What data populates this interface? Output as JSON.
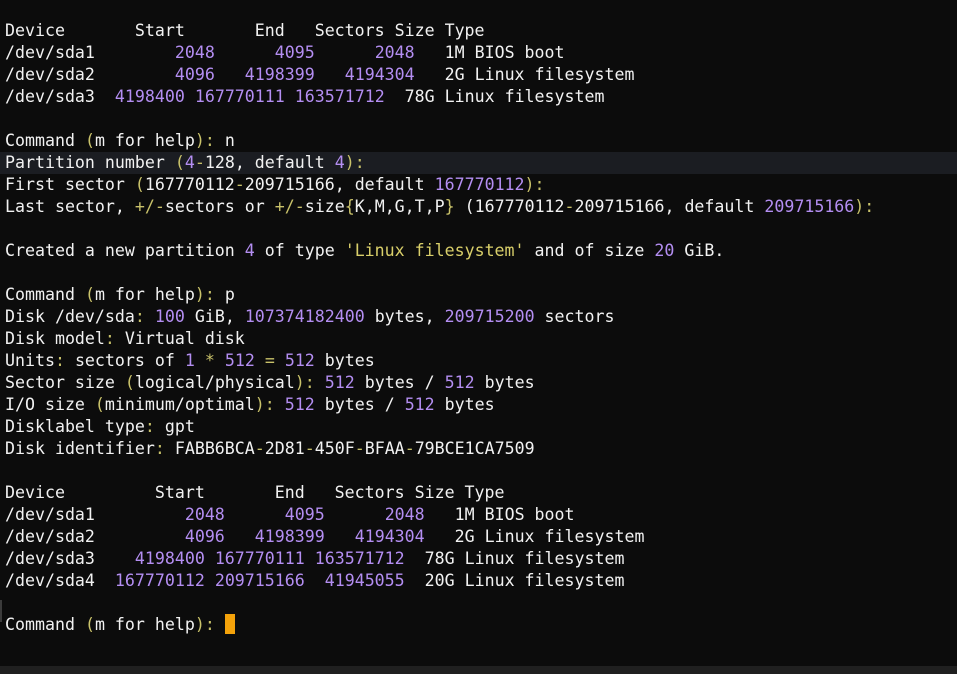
{
  "table1": {
    "header": "Device       Start       End   Sectors Size Type",
    "rows": [
      {
        "dev": "/dev/sda1     ",
        "start": "   2048",
        "sp1": "      ",
        "end": "4095",
        "sp2": "      ",
        "sectors": "2048",
        "size": "   1M",
        "type": " BIOS boot"
      },
      {
        "dev": "/dev/sda2     ",
        "start": "   4096",
        "sp1": "   ",
        "end": "4198399",
        "sp2": "   ",
        "sectors": "4194304",
        "size": "   2G",
        "type": " Linux filesystem"
      },
      {
        "dev": "/dev/sda3  ",
        "start": "4198400",
        "sp1": " ",
        "end": "167770111",
        "sp2": " ",
        "sectors": "163571712",
        "size": "  78G",
        "type": " Linux filesystem"
      }
    ]
  },
  "cmd1": {
    "prompt": "Command ",
    "paren_open": "(",
    "m": "m for help",
    "paren_close": ")",
    "colon": ":",
    "input": " n"
  },
  "partnum": {
    "a": "Partition number ",
    "b": "(",
    "c": "4",
    "d": "-",
    "e": "128, default ",
    "f": "4",
    "g": "):"
  },
  "firstsector": {
    "a": "First sector ",
    "b": "(",
    "c": "167770112",
    "d": "-",
    "e": "209715166, default ",
    "f": "167770112",
    "g": "):"
  },
  "lastsector": {
    "a": "Last sector, ",
    "b": "+/",
    "c": "-",
    "d": "sectors or ",
    "e": "+/",
    "f": "-",
    "g": "size",
    "h": "{",
    "i": "K,M,G,T,P",
    "j": "}",
    "k": " (",
    "l": "167770112",
    "m": "-",
    "n": "209715166, default ",
    "o": "209715166",
    "p": "):"
  },
  "created": {
    "a": "Created a new partition ",
    "b": "4",
    "c": " of type ",
    "d": "'Linux filesystem'",
    "e": " and of size ",
    "f": "20",
    "g": " GiB."
  },
  "cmd2": {
    "prompt": "Command ",
    "paren_open": "(",
    "m": "m for help",
    "paren_close": ")",
    "colon": ":",
    "input": " p"
  },
  "disk": {
    "a": "Disk /dev/sda",
    "b": ":",
    "c": " ",
    "d": "100",
    "e": " GiB, ",
    "f": "107374182400",
    "g": " bytes, ",
    "h": "209715200",
    "i": " sectors"
  },
  "model": {
    "a": "Disk model",
    "b": ":",
    "c": " Virtual disk"
  },
  "units": {
    "a": "Units",
    "b": ":",
    "c": " sectors of ",
    "d": "1",
    "e": " ",
    "f": "*",
    "g": " ",
    "h": "512",
    "i": " ",
    "j": "=",
    "k": " ",
    "l": "512",
    "m": " bytes"
  },
  "sectorsize": {
    "a": "Sector size ",
    "b": "(",
    "c": "logical/physical",
    "d": ")",
    "e": ":",
    "f": " ",
    "g": "512",
    "h": " bytes / ",
    "i": "512",
    "j": " bytes"
  },
  "iosize": {
    "a": "I/O size ",
    "b": "(",
    "c": "minimum/optimal",
    "d": ")",
    "e": ":",
    "f": " ",
    "g": "512",
    "h": " bytes / ",
    "i": "512",
    "j": " bytes"
  },
  "labeltype": {
    "a": "Disklabel type",
    "b": ":",
    "c": " gpt"
  },
  "identifier": {
    "a": "Disk identifier",
    "b": ":",
    "c": " FABB6BCA",
    "d": "-",
    "e": "2D81",
    "f": "-",
    "g": "450F",
    "h": "-",
    "i": "BFAA",
    "j": "-",
    "k": "79BCE1CA7509"
  },
  "table2": {
    "header": "Device         Start       End   Sectors Size Type",
    "rows": [
      {
        "dev": "/dev/sda1       ",
        "start": "  2048",
        "sp1": "      ",
        "end": "4095",
        "sp2": "      ",
        "sectors": "2048",
        "size": "   1M",
        "type": " BIOS boot"
      },
      {
        "dev": "/dev/sda2       ",
        "start": "  4096",
        "sp1": "   ",
        "end": "4198399",
        "sp2": "   ",
        "sectors": "4194304",
        "size": "   2G",
        "type": " Linux filesystem"
      },
      {
        "dev": "/dev/sda3    ",
        "start": "4198400",
        "sp1": " ",
        "end": "167770111",
        "sp2": " ",
        "sectors": "163571712",
        "size": "  78G",
        "type": " Linux filesystem"
      },
      {
        "dev": "/dev/sda4  ",
        "start": "167770112",
        "sp1": " ",
        "end": "209715166",
        "sp2": "  ",
        "sectors": "41945055",
        "size": "  20G",
        "type": " Linux filesystem"
      }
    ]
  },
  "cmd3": {
    "prompt": "Command ",
    "paren_open": "(",
    "m": "m for help",
    "paren_close": ")",
    "colon": ":",
    "input": " "
  },
  "colors": {
    "background": "#0c0c0c",
    "text": "#cccccc",
    "number": "#b48ef2",
    "punct": "#c9c26a",
    "cursor": "#f4a20a"
  }
}
